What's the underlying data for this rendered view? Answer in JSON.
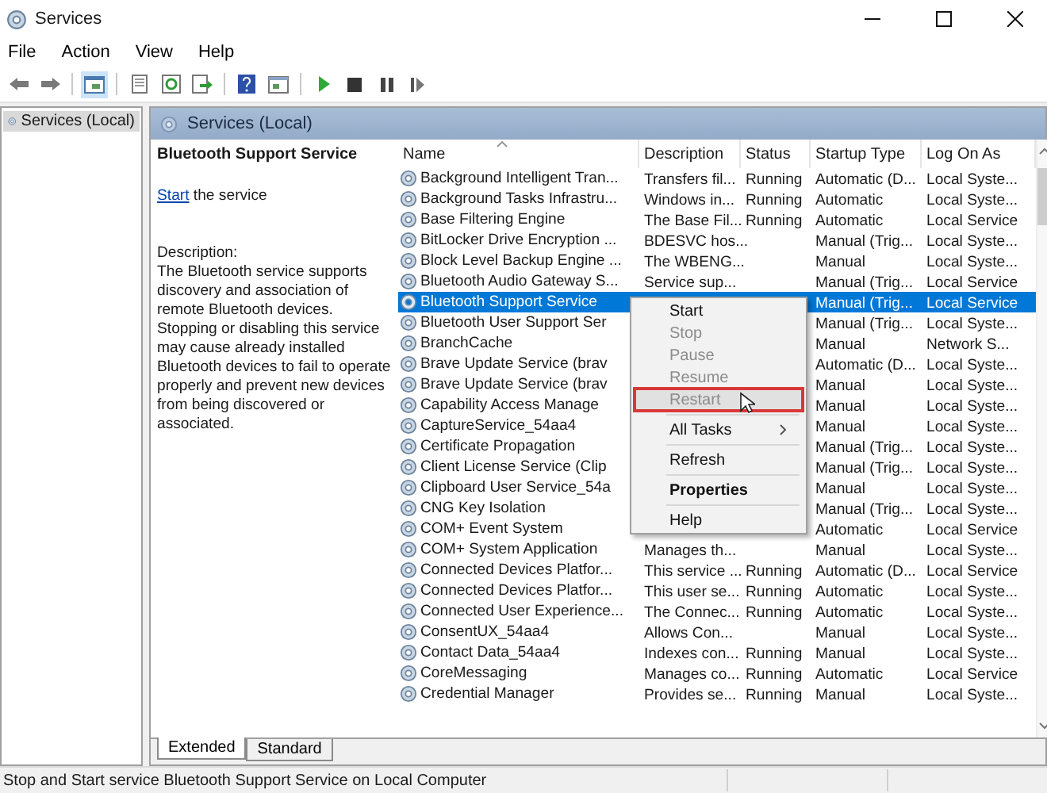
{
  "window": {
    "title": "Services"
  },
  "menu_bar": [
    "File",
    "Action",
    "View",
    "Help"
  ],
  "tree": {
    "items": [
      {
        "label": "Services (Local)",
        "selected": true
      }
    ]
  },
  "pane_header": "Services (Local)",
  "details": {
    "title": "Bluetooth Support Service",
    "link": "Start",
    "link_suffix": " the service",
    "description_label": "Description:",
    "description": "The Bluetooth service supports discovery and association of remote Bluetooth devices.  Stopping or disabling this service may cause already installed Bluetooth devices to fail to operate properly and prevent new devices from being discovered or associated."
  },
  "table": {
    "columns": [
      "Name",
      "Description",
      "Status",
      "Startup Type",
      "Log On As"
    ],
    "rows": [
      {
        "name": "Background Intelligent Tran...",
        "description": "Transfers fil...",
        "status": "Running",
        "startup": "Automatic (D...",
        "logon": "Local Syste...",
        "selected": false
      },
      {
        "name": "Background Tasks Infrastru...",
        "description": "Windows in...",
        "status": "Running",
        "startup": "Automatic",
        "logon": "Local Syste...",
        "selected": false
      },
      {
        "name": "Base Filtering Engine",
        "description": "The Base Fil...",
        "status": "Running",
        "startup": "Automatic",
        "logon": "Local Service",
        "selected": false
      },
      {
        "name": "BitLocker Drive Encryption ...",
        "description": "BDESVC hos...",
        "startup": "Manual (Trig...",
        "logon": "Local Syste...",
        "selected": false
      },
      {
        "name": "Block Level Backup Engine ...",
        "description": "The WBENG...",
        "startup": "Manual",
        "logon": "Local Syste...",
        "selected": false
      },
      {
        "name": "Bluetooth Audio Gateway S...",
        "description": "Service sup...",
        "startup": "Manual (Trig...",
        "logon": "Local Service",
        "selected": false
      },
      {
        "name": "Bluetooth Support Service",
        "startup": "Manual (Trig...",
        "logon": "Local Service",
        "selected": true
      },
      {
        "name": "Bluetooth User Support Ser",
        "startup": "Manual (Trig...",
        "logon": "Local Syste...",
        "selected": false
      },
      {
        "name": "BranchCache",
        "startup": "Manual",
        "logon": "Network S...",
        "selected": false
      },
      {
        "name": "Brave Update Service (brav",
        "startup": "Automatic (D...",
        "logon": "Local Syste...",
        "selected": false
      },
      {
        "name": "Brave Update Service (brav",
        "startup": "Manual",
        "logon": "Local Syste...",
        "selected": false
      },
      {
        "name": "Capability Access Manage",
        "startup": "Manual",
        "logon": "Local Syste...",
        "selected": false
      },
      {
        "name": "CaptureService_54aa4",
        "startup": "Manual",
        "logon": "Local Syste...",
        "selected": false
      },
      {
        "name": "Certificate Propagation",
        "startup": "Manual (Trig...",
        "logon": "Local Syste...",
        "selected": false
      },
      {
        "name": "Client License Service (Clip",
        "startup": "Manual (Trig...",
        "logon": "Local Syste...",
        "selected": false
      },
      {
        "name": "Clipboard User Service_54a",
        "startup": "Manual",
        "logon": "Local Syste...",
        "selected": false
      },
      {
        "name": "CNG Key Isolation",
        "startup": "Manual (Trig...",
        "logon": "Local Syste...",
        "selected": false
      },
      {
        "name": "COM+ Event System",
        "startup": "Automatic",
        "logon": "Local Service",
        "selected": false
      },
      {
        "name": "COM+ System Application",
        "description": "Manages th...",
        "startup": "Manual",
        "logon": "Local Syste...",
        "selected": false
      },
      {
        "name": "Connected Devices Platfor...",
        "description": "This service ...",
        "status": "Running",
        "startup": "Automatic (D...",
        "logon": "Local Service",
        "selected": false
      },
      {
        "name": "Connected Devices Platfor...",
        "description": "This user se...",
        "status": "Running",
        "startup": "Automatic",
        "logon": "Local Syste...",
        "selected": false
      },
      {
        "name": "Connected User Experience...",
        "description": "The Connec...",
        "status": "Running",
        "startup": "Automatic",
        "logon": "Local Syste...",
        "selected": false
      },
      {
        "name": "ConsentUX_54aa4",
        "description": "Allows Con...",
        "startup": "Manual",
        "logon": "Local Syste...",
        "selected": false
      },
      {
        "name": "Contact Data_54aa4",
        "description": "Indexes con...",
        "status": "Running",
        "startup": "Manual",
        "logon": "Local Syste...",
        "selected": false
      },
      {
        "name": "CoreMessaging",
        "description": "Manages co...",
        "status": "Running",
        "startup": "Automatic",
        "logon": "Local Service",
        "selected": false
      },
      {
        "name": "Credential Manager",
        "description": "Provides se...",
        "status": "Running",
        "startup": "Manual",
        "logon": "Local Syste...",
        "selected": false
      }
    ]
  },
  "context_menu": {
    "items": [
      {
        "kind": "item",
        "label": "Start",
        "disabled": false,
        "selected": false,
        "highlighted": false,
        "default": false
      },
      {
        "kind": "item",
        "label": "Stop",
        "disabled": true,
        "selected": false,
        "highlighted": false,
        "default": false
      },
      {
        "kind": "item",
        "label": "Pause",
        "disabled": true,
        "selected": false,
        "highlighted": false,
        "default": false
      },
      {
        "kind": "item",
        "label": "Resume",
        "disabled": true,
        "selected": false,
        "highlighted": false,
        "default": false
      },
      {
        "kind": "item",
        "label": "Restart",
        "disabled": true,
        "selected": true,
        "highlighted": true,
        "default": false
      },
      {
        "kind": "separator"
      },
      {
        "kind": "submenu",
        "label": "All Tasks",
        "disabled": false,
        "selected": false,
        "highlighted": false,
        "default": false
      },
      {
        "kind": "separator"
      },
      {
        "kind": "item",
        "label": "Refresh",
        "disabled": false,
        "selected": false,
        "highlighted": false,
        "default": false
      },
      {
        "kind": "separator"
      },
      {
        "kind": "item",
        "label": "Properties",
        "disabled": false,
        "selected": false,
        "highlighted": false,
        "default": true
      },
      {
        "kind": "separator"
      },
      {
        "kind": "item",
        "label": "Help",
        "disabled": false,
        "selected": false,
        "highlighted": false,
        "default": false
      }
    ]
  },
  "bottom_tabs": [
    {
      "label": "Extended",
      "selected": true
    },
    {
      "label": "Standard",
      "selected": false
    }
  ],
  "status_bar": "Stop and Start service Bluetooth Support Service on Local Computer"
}
